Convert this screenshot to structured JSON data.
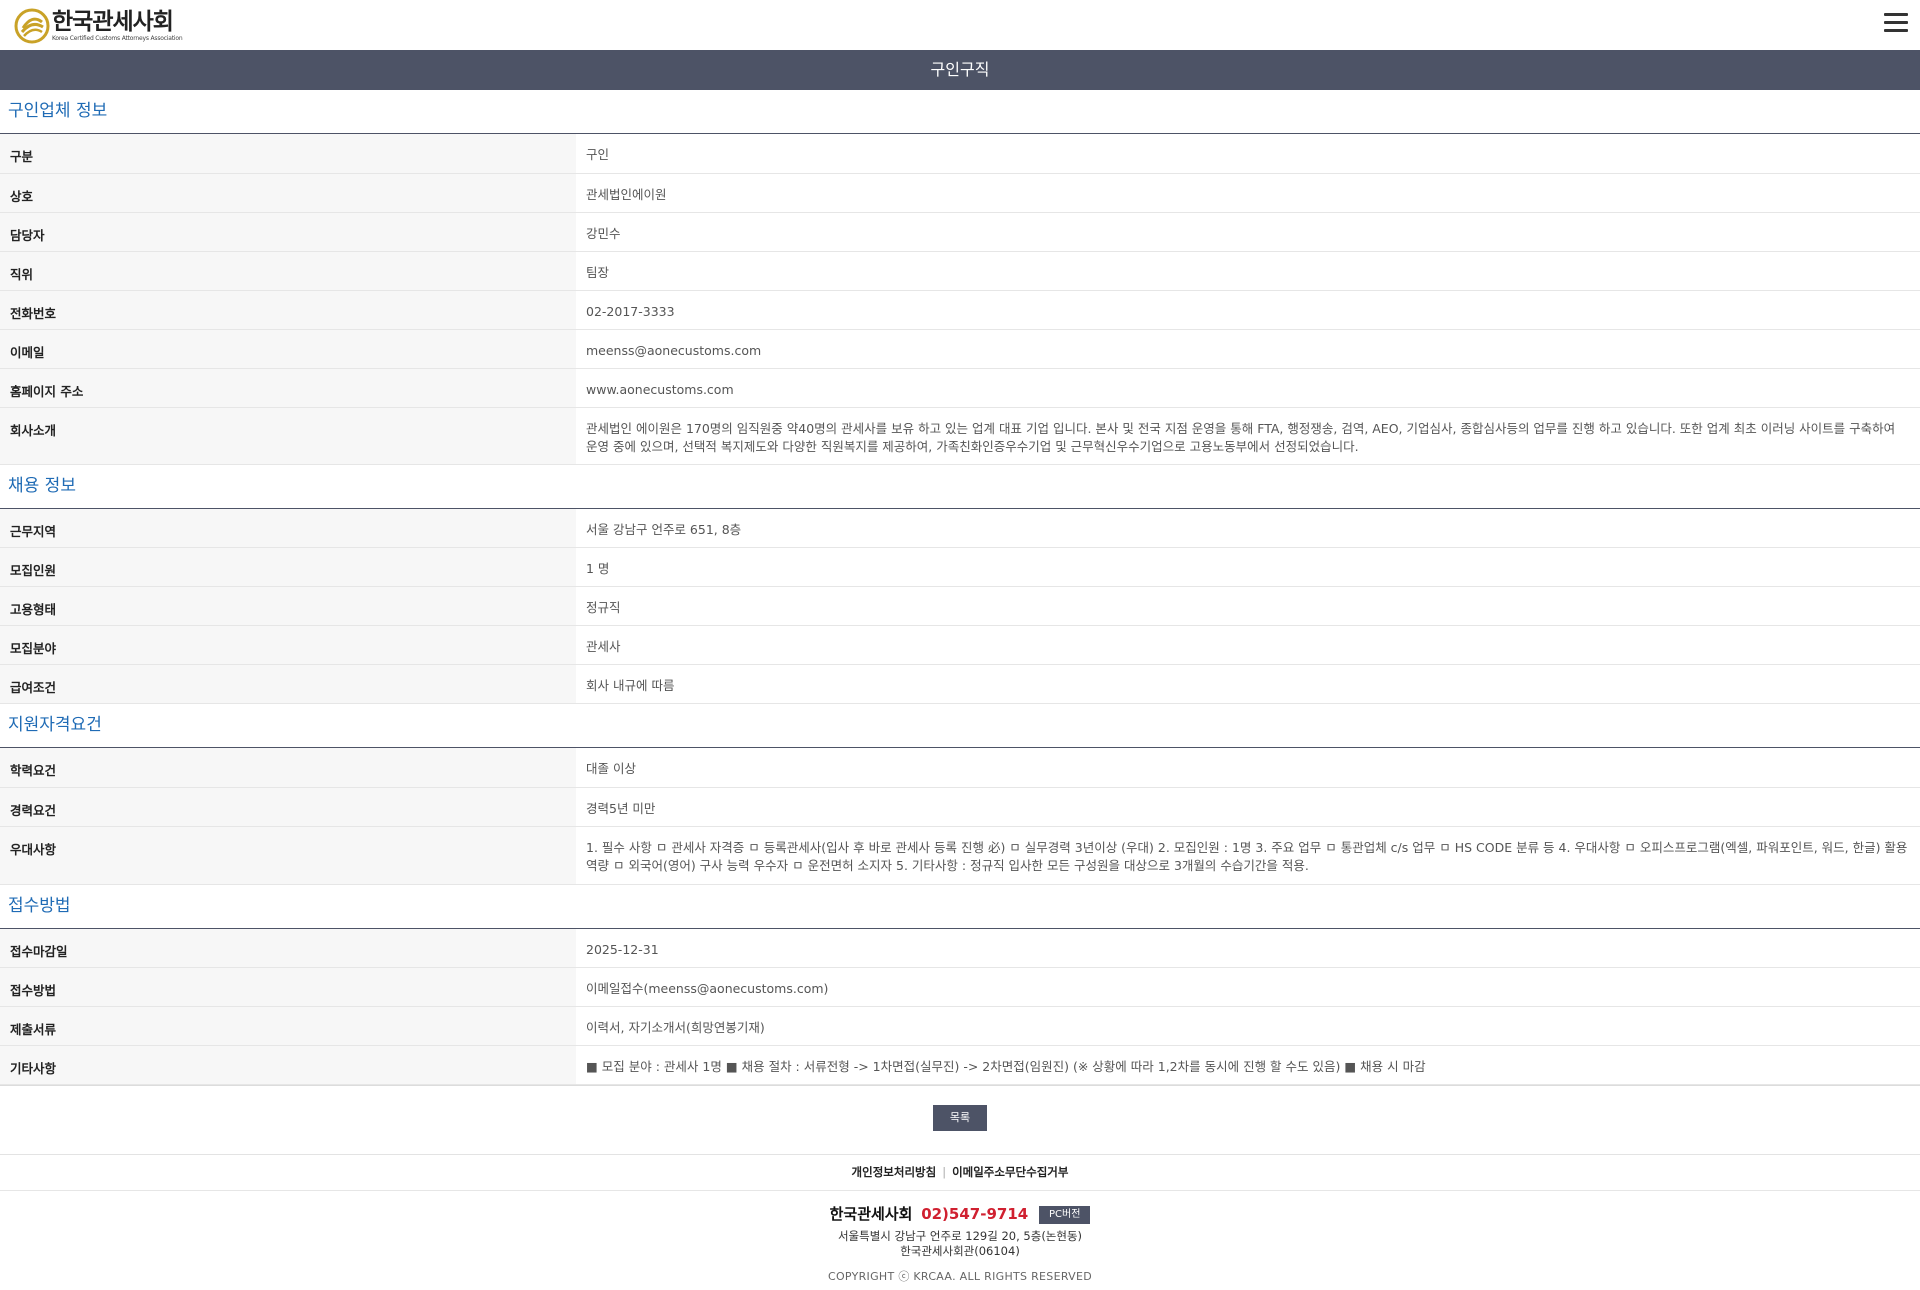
{
  "header": {
    "logo_name": "한국관세사회",
    "logo_sub": "Korea Certified Customs Attorneys Association"
  },
  "page_title": "구인구직",
  "sections": {
    "company": {
      "title": "구인업체 정보",
      "rows": [
        {
          "label": "구분",
          "value": "구인"
        },
        {
          "label": "상호",
          "value": "관세법인에이원"
        },
        {
          "label": "담당자",
          "value": "강민수"
        },
        {
          "label": "직위",
          "value": "팀장"
        },
        {
          "label": "전화번호",
          "value": "02-2017-3333"
        },
        {
          "label": "이메일",
          "value": "meenss@aonecustoms.com"
        },
        {
          "label": "홈페이지 주소",
          "value": "www.aonecustoms.com"
        },
        {
          "label": "회사소개",
          "value": "관세법인 에이원은 170명의 임직원중 약40명의 관세사를 보유 하고 있는 업계 대표 기업 입니다. 본사 및 전국 지점 운영을 통해 FTA, 행정쟁송, 검역, AEO, 기업심사, 종합심사등의 업무를 진행 하고 있습니다. 또한 업계 최초 이러닝 사이트를 구축하여 운영 중에 있으며, 선택적 복지제도와 다양한 직원복지를 제공하여, 가족친화인증우수기업 및 근무혁신우수기업으로 고용노동부에서 선정되었습니다."
        }
      ]
    },
    "recruit": {
      "title": "채용 정보",
      "rows": [
        {
          "label": "근무지역",
          "value": "서울 강남구 언주로 651, 8층"
        },
        {
          "label": "모집인원",
          "value": "1 명"
        },
        {
          "label": "고용형태",
          "value": "정규직"
        },
        {
          "label": "모집분야",
          "value": "관세사"
        },
        {
          "label": "급여조건",
          "value": "회사 내규에 따름"
        }
      ]
    },
    "qualification": {
      "title": "지원자격요건",
      "rows": [
        {
          "label": "학력요건",
          "value": "대졸 이상"
        },
        {
          "label": "경력요건",
          "value": "경력5년 미만"
        },
        {
          "label": "우대사항",
          "value": "1. 필수 사항 ㅁ 관세사 자격증 ㅁ 등록관세사(입사 후 바로 관세사 등록 진행 必) ㅁ 실무경력 3년이상 (우대) 2. 모집인원 : 1명 3. 주요 업무 ㅁ 통관업체 c/s 업무 ㅁ HS CODE 분류 등 4. 우대사항 ㅁ 오피스프로그램(엑셀, 파워포인트, 워드, 한글) 활용 역량 ㅁ 외국어(영어) 구사 능력 우수자 ㅁ 운전면허 소지자 5. 기타사항 : 정규직 입사한 모든 구성원을 대상으로 3개월의 수습기간을 적용."
        }
      ]
    },
    "apply": {
      "title": "접수방법",
      "rows": [
        {
          "label": "접수마감일",
          "value": "2025-12-31"
        },
        {
          "label": "접수방법",
          "value": "이메일접수(meenss@aonecustoms.com)"
        },
        {
          "label": "제출서류",
          "value": "이력서, 자기소개서(희망연봉기재)"
        },
        {
          "label": "기타사항",
          "value": "■ 모집 분야 : 관세사 1명 ■ 채용 절차 : 서류전형 -> 1차면접(실무진) -> 2차면접(임원진) (※ 상황에 따라 1,2차를 동시에 진행 할 수도 있음) ■ 채용 시 마감"
        }
      ]
    }
  },
  "list_button": "목록",
  "footer_links": [
    "개인정보처리방침",
    "이메일주소무단수집거부"
  ],
  "footer": {
    "name": "한국관세사회",
    "tel": "02)547-9714",
    "pc_button": "PC버전",
    "address": "서울특별시 강남구 언주로 129길 20, 5층(논현동)",
    "building": "한국관세사회관(06104)",
    "copyright": "COPYRIGHT ⓒ KRCAA. ALL RIGHTS RESERVED"
  },
  "colors": {
    "bar": "#4d5366",
    "section_title": "#1f6bb5",
    "tel": "#d02030",
    "logo_gold": "#c9a227"
  }
}
